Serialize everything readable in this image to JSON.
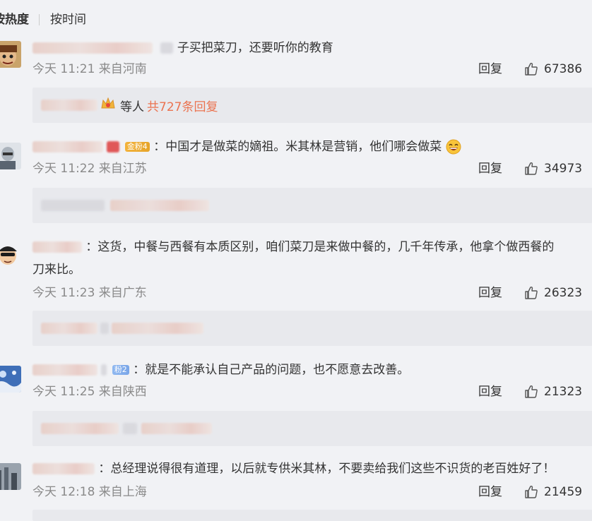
{
  "tabs": {
    "hot": "按热度",
    "time": "按时间"
  },
  "ui": {
    "reply_label": "回复"
  },
  "comments": [
    {
      "text": "子买把菜刀，还要听你的教育",
      "time": "今天 11:21 来自河南",
      "likes": "67386",
      "sub": {
        "suffix": "等人",
        "count": "共727条回复"
      }
    },
    {
      "badge": "金粉4",
      "text": "：中国才是做菜的嫡祖。米其林是营销，他们哪会做菜",
      "time": "今天 11:22 来自江苏",
      "likes": "34973"
    },
    {
      "text": "：这货，中餐与西餐有本质区别，咱们菜刀是来做中餐的，几千年传承，他拿个做西餐的",
      "text2": "刀来比。",
      "time": "今天 11:23 来自广东",
      "likes": "26323"
    },
    {
      "badge": "粉2",
      "text": "：就是不能承认自己产品的问题，也不愿意去改善。",
      "time": "今天 11:25 来自陕西",
      "likes": "21323"
    },
    {
      "text": "：总经理说得很有道理，以后就专供米其林，不要卖给我们这些不识货的老百姓好了！",
      "time": "今天 12:18 来自上海",
      "likes": "21459"
    }
  ],
  "icons": {
    "like": "thumbs-up-icon",
    "crown": "crown-icon",
    "laugh": "laughing-emoji-icon"
  }
}
